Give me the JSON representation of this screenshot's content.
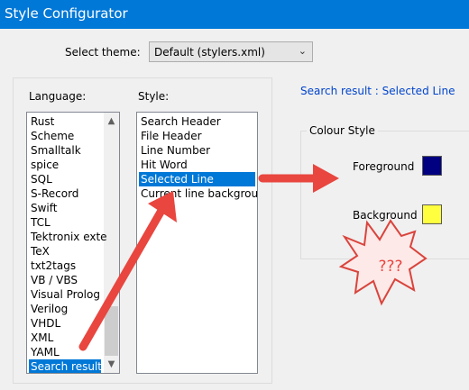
{
  "window": {
    "title": "Style Configurator"
  },
  "theme": {
    "label": "Select theme:",
    "value": "Default (stylers.xml)"
  },
  "language": {
    "label": "Language:",
    "items": [
      "Rust",
      "Scheme",
      "Smalltalk",
      "spice",
      "SQL",
      "S-Record",
      "Swift",
      "TCL",
      "Tektronix exte",
      "TeX",
      "txt2tags",
      "VB / VBS",
      "Visual Prolog",
      "Verilog",
      "VHDL",
      "XML",
      "YAML",
      "Search result"
    ],
    "selected": "Search result"
  },
  "style": {
    "label": "Style:",
    "items": [
      "Search Header",
      "File Header",
      "Line Number",
      "Hit Word",
      "Selected Line",
      "Current line backgroun"
    ],
    "selected": "Selected Line"
  },
  "heading": "Search result : Selected Line",
  "colour_style": {
    "label": "Colour Style",
    "foreground": {
      "label": "Foreground",
      "color": "#000080"
    },
    "background": {
      "label": "Background",
      "color": "#ffff40"
    }
  },
  "annotation": {
    "burst_text": "???",
    "arrow_color": "#e8463f",
    "burst_fill": "#fde9e8"
  }
}
